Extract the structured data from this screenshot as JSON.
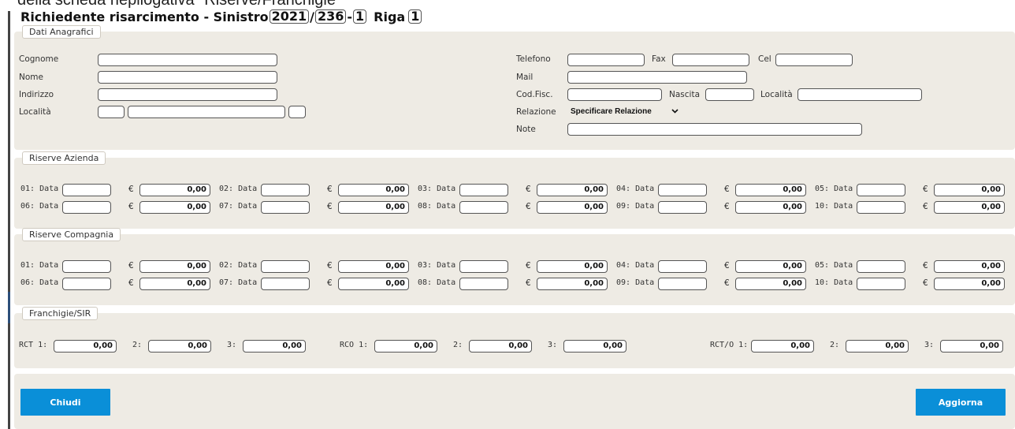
{
  "top_cut_text": "della scheda riepilogativa \"Riserve/Franchigie\"",
  "title": {
    "prefix": "Richiedente risarcimento - Sinistro",
    "year": "2021",
    "sep1": "/",
    "number": "236",
    "sep2": "-",
    "sub": "1",
    "riga_label": "Riga",
    "riga": "1"
  },
  "anagrafici": {
    "legend": "Dati Anagrafici",
    "cognome_label": "Cognome",
    "nome_label": "Nome",
    "indirizzo_label": "Indirizzo",
    "localita_label": "Località",
    "telefono_label": "Telefono",
    "fax_label": "Fax",
    "cel_label": "Cel",
    "mail_label": "Mail",
    "codfisc_label": "Cod.Fisc.",
    "nascita_label": "Nascita",
    "localita2_label": "Località",
    "relazione_label": "Relazione",
    "relazione_value": "Specificare Relazione",
    "note_label": "Note"
  },
  "riserve_azienda": {
    "legend": "Riserve Azienda",
    "euro": "€",
    "rows": [
      [
        {
          "label": "01: Data",
          "amount": "0,00"
        },
        {
          "label": "02: Data",
          "amount": "0,00"
        },
        {
          "label": "03: Data",
          "amount": "0,00"
        },
        {
          "label": "04: Data",
          "amount": "0,00"
        },
        {
          "label": "05: Data",
          "amount": "0,00"
        }
      ],
      [
        {
          "label": "06: Data",
          "amount": "0,00"
        },
        {
          "label": "07: Data",
          "amount": "0,00"
        },
        {
          "label": "08: Data",
          "amount": "0,00"
        },
        {
          "label": "09: Data",
          "amount": "0,00"
        },
        {
          "label": "10: Data",
          "amount": "0,00"
        }
      ]
    ]
  },
  "riserve_compagnia": {
    "legend": "Riserve Compagnia",
    "euro": "€",
    "rows": [
      [
        {
          "label": "01: Data",
          "amount": "0,00"
        },
        {
          "label": "02: Data",
          "amount": "0,00"
        },
        {
          "label": "03: Data",
          "amount": "0,00"
        },
        {
          "label": "04: Data",
          "amount": "0,00"
        },
        {
          "label": "05: Data",
          "amount": "0,00"
        }
      ],
      [
        {
          "label": "06: Data",
          "amount": "0,00"
        },
        {
          "label": "07: Data",
          "amount": "0,00"
        },
        {
          "label": "08: Data",
          "amount": "0,00"
        },
        {
          "label": "09: Data",
          "amount": "0,00"
        },
        {
          "label": "10: Data",
          "amount": "0,00"
        }
      ]
    ]
  },
  "franchigie": {
    "legend": "Franchigie/SIR",
    "groups": [
      {
        "label": "RCT 1:",
        "values": [
          {
            "label": "",
            "amount": "0,00"
          },
          {
            "label": "2:",
            "amount": "0,00"
          },
          {
            "label": "3:",
            "amount": "0,00"
          }
        ]
      },
      {
        "label": "RCO 1:",
        "values": [
          {
            "label": "",
            "amount": "0,00"
          },
          {
            "label": "2:",
            "amount": "0,00"
          },
          {
            "label": "3:",
            "amount": "0,00"
          }
        ]
      },
      {
        "label": "RCT/O 1:",
        "values": [
          {
            "label": "",
            "amount": "0,00"
          },
          {
            "label": "2:",
            "amount": "0,00"
          },
          {
            "label": "3:",
            "amount": "0,00"
          }
        ]
      }
    ]
  },
  "buttons": {
    "close": "Chiudi",
    "update": "Aggiorna"
  },
  "colors": {
    "button": "#0a8fd8",
    "panel": "#eeebe4"
  }
}
